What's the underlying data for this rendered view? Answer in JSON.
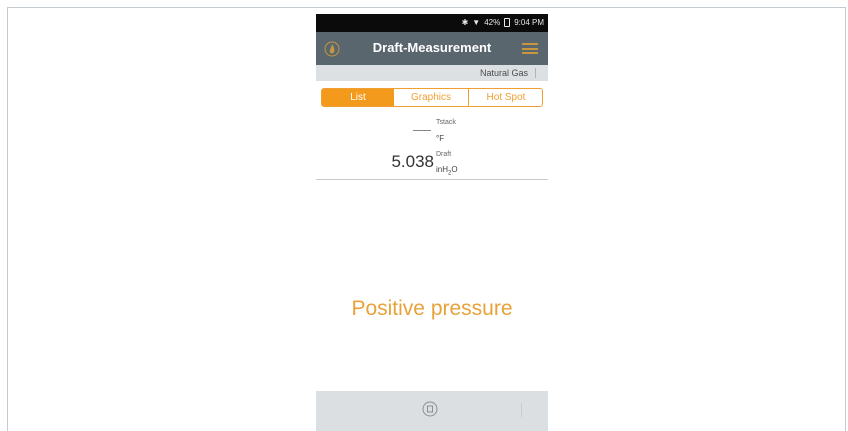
{
  "status_bar": {
    "battery": "42%",
    "time": "9:04 PM"
  },
  "app_bar": {
    "title": "Draft-Measurement"
  },
  "fuel": {
    "label": "Natural Gas"
  },
  "tabs": [
    {
      "label": "List",
      "active": true
    },
    {
      "label": "Graphics",
      "active": false
    },
    {
      "label": "Hot Spot",
      "active": false
    }
  ],
  "readings": {
    "tstack": {
      "label": "Tstack",
      "unit": "°F"
    },
    "draft": {
      "label": "Draft",
      "value": "5.038",
      "unit_main": "inH",
      "unit_sub": "2",
      "unit_end": "O"
    }
  },
  "message": "Positive pressure",
  "colors": {
    "accent": "#f39a1c",
    "appbar": "#5a666e",
    "message": "#e9a23a"
  },
  "icons": [
    "bluetooth-icon",
    "wifi-icon",
    "battery-icon",
    "flame-icon",
    "menu-icon",
    "stop-icon"
  ]
}
